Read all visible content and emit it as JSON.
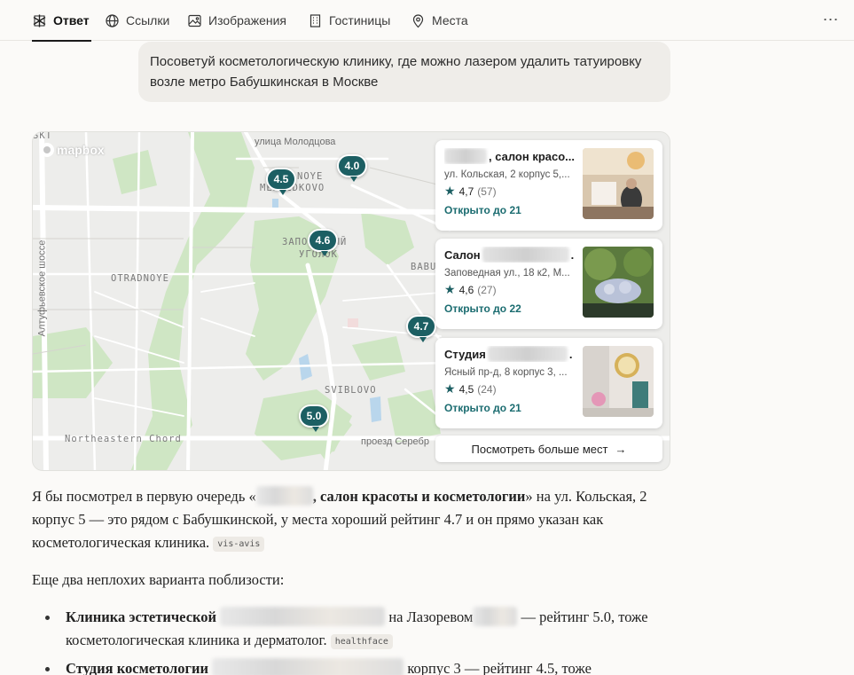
{
  "nav": {
    "tabs": [
      {
        "label": "Ответ",
        "icon": "answer-icon",
        "active": true
      },
      {
        "label": "Ссылки",
        "icon": "globe-icon"
      },
      {
        "label": "Изображения",
        "icon": "image-icon"
      },
      {
        "label": "Гостиницы",
        "icon": "building-icon"
      },
      {
        "label": "Места",
        "icon": "location-pin-icon"
      }
    ],
    "more_icon": "ellipsis-icon"
  },
  "query": {
    "text": "Посоветуй косметологическую клинику, где можно лазером удалить татуировку возле метро Бабушкинская в Москве"
  },
  "map": {
    "attribution": "mapbox",
    "labels": {
      "medvedkovo_1": "NOYE",
      "medvedkovo_2": "MEDVEDKOVO",
      "zapovedny_1": "ЗАПОВЕДНЫЙ",
      "zapovedny_2": "УГОЛОК",
      "otradnoye": "OTRADNOYE",
      "babushkinsky": "BABU",
      "sviblovo": "SVIBLOVO",
      "northeastern": "Northeastern Chord",
      "molodtsova": "улица Молодцова",
      "altufyevskoe": "Алтуфьевское шоссе",
      "serebryakova": "проезд Серебр",
      "skt": "SKT"
    },
    "pins": [
      "4.5",
      "4.0",
      "4.6",
      "4.7",
      "5.0"
    ]
  },
  "places": [
    {
      "name_suffix": ", салон красо...",
      "address": "ул. Кольская, 2 корпус 5,...",
      "rating": "4,7",
      "count": "(57)",
      "hours": "Открыто до 21"
    },
    {
      "name_prefix": "Салон",
      "name_suffix": ".",
      "address": "Заповедная ул., 18 к2, М...",
      "rating": "4,6",
      "count": "(27)",
      "hours": "Открыто до 22"
    },
    {
      "name_prefix": "Студия",
      "name_suffix": ".",
      "address": "Ясный пр-д, 8 корпус 3, ...",
      "rating": "4,5",
      "count": "(24)",
      "hours": "Открыто до 21"
    }
  ],
  "see_more": {
    "label": "Посмотреть больше мест",
    "icon": "arrow-right-icon"
  },
  "answer": {
    "p1_start": "Я бы посмотрел в первую очередь «",
    "p1_bold": ", салон красоты и косметологии",
    "p1_end": "» на ул. Кольская, 2 корпус 5 — это рядом с Бабушкинской, у места хороший рейтинг 4.7 и он прямо указан как косметологическая клиника.",
    "p1_cite": "vis-avis",
    "p2": "Еще два неплохих варианта поблизости:",
    "li1_bold": "Клиника эстетической",
    "li1_mid": "на Лазоревом",
    "li1_end": "— рейтинг 5.0, тоже косметологическая клиника и дерматолог.",
    "li1_cite": "healthface",
    "li2_bold": "Студия косметологии",
    "li2_end": "корпус 3 — рейтинг 4.5, тоже"
  }
}
